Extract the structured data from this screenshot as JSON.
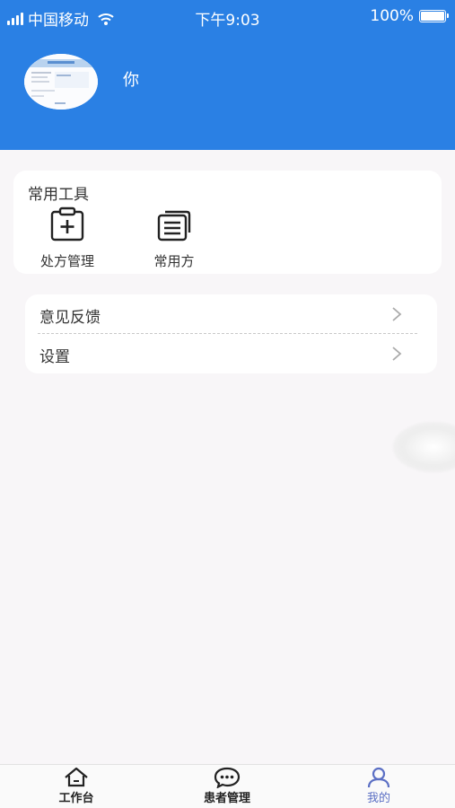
{
  "status_bar": {
    "carrier": "中国移动",
    "time": "下午9:03",
    "battery": "100%",
    "battery_level": 1.0
  },
  "profile": {
    "name": "你"
  },
  "tools": {
    "title": "常用工具",
    "items": [
      {
        "label": "处方管理",
        "icon": "prescription-add-icon"
      },
      {
        "label": "常用方",
        "icon": "document-stack-icon"
      }
    ]
  },
  "menu": {
    "items": [
      {
        "label": "意见反馈",
        "icon": "chevron-right-icon"
      },
      {
        "label": "设置",
        "icon": "chevron-right-icon"
      }
    ]
  },
  "tabbar": {
    "items": [
      {
        "label": "工作台",
        "icon": "home-icon",
        "active": false
      },
      {
        "label": "患者管理",
        "icon": "chat-icon",
        "active": false
      },
      {
        "label": "我的",
        "icon": "user-icon",
        "active": true
      }
    ]
  },
  "colors": {
    "header": "#2a80e4",
    "background": "#f8f6f8",
    "tab_active": "#5b6fc4"
  }
}
